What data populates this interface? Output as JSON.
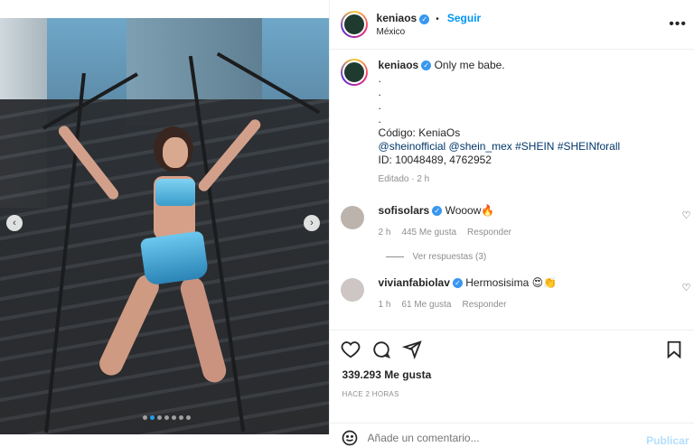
{
  "header": {
    "username": "keniaos",
    "follow_label": "Seguir",
    "separator": "•",
    "location": "México",
    "more_icon": "ellipsis-icon"
  },
  "caption": {
    "username": "keniaos",
    "text": "Only me babe.",
    "dots": [
      ".",
      ".",
      ".",
      "."
    ],
    "code_line": "Código: KeniaOs",
    "tags": [
      "@sheinofficial",
      "@shein_mex",
      "#SHEIN",
      "#SHEINforall"
    ],
    "id_line": "ID: 10048489, 4762952",
    "edited": "Editado · 2 h"
  },
  "comments": [
    {
      "username": "sofisolars",
      "text": "Wooow🔥",
      "time": "2 h",
      "likes": "445 Me gusta",
      "reply": "Responder",
      "replies": "Ver respuestas (3)"
    },
    {
      "username": "vivianfabiolav",
      "text": "Hermosisima 😍👏",
      "time": "1 h",
      "likes": "61 Me gusta",
      "reply": "Responder"
    }
  ],
  "actions": {
    "likes": "339.293 Me gusta",
    "time_ago": "HACE 2 HORAS",
    "comment_placeholder": "Añade un comentario...",
    "publish_label": "Publicar"
  },
  "carousel": {
    "prev_icon": "chevron-left-icon",
    "next_icon": "chevron-right-icon",
    "dot_count": 7,
    "active_index": 1
  },
  "colors": {
    "accent": "#0095f6",
    "verified": "#3897f0",
    "muted": "#8e8e8e"
  }
}
